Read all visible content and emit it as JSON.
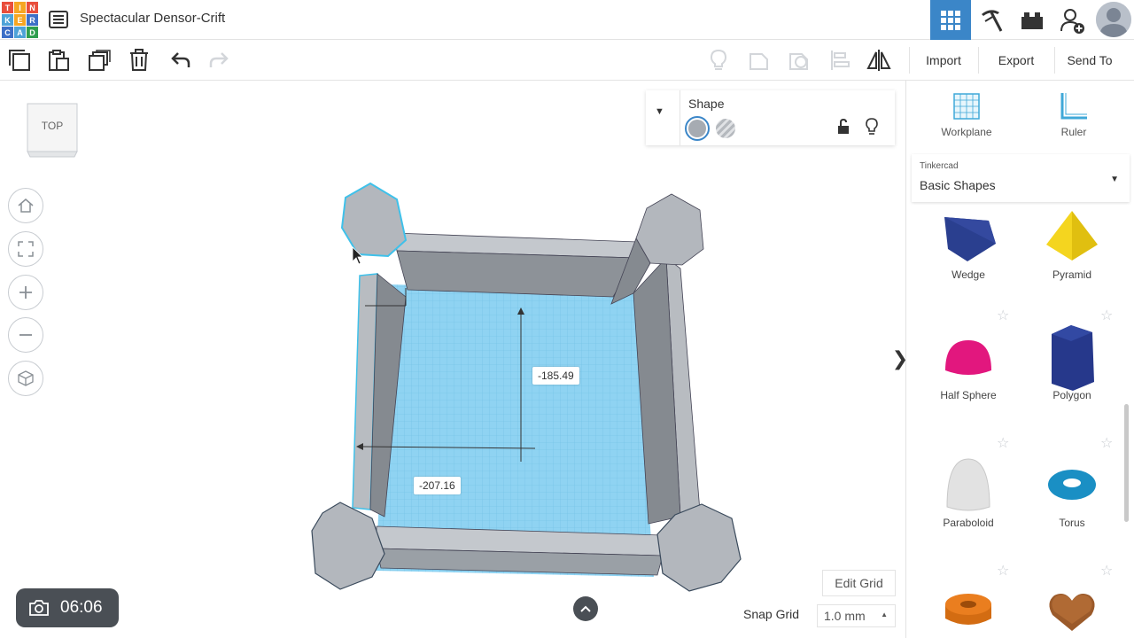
{
  "app": {
    "logo_letters": [
      "T",
      "I",
      "N",
      "K",
      "E",
      "R",
      "C",
      "A",
      "D"
    ],
    "logo_colors": [
      "#e94e3c",
      "#f6a623",
      "#e94e3c",
      "#4ea3d8",
      "#f6a623",
      "#3c6fc7",
      "#3c6fc7",
      "#4ea3d8",
      "#2f9e4f"
    ],
    "project_title": "Spectacular Densor-Crift"
  },
  "header": {
    "icons": [
      "grid-view-icon",
      "build-pickaxe-icon",
      "lego-brick-icon",
      "add-user-icon",
      "profile-avatar"
    ],
    "accent": "#3b86c8"
  },
  "toolbar": {
    "import_label": "Import",
    "export_label": "Export",
    "send_to_label": "Send To"
  },
  "viewport": {
    "viewcube_label": "TOP",
    "shape_panel": {
      "title": "Shape"
    },
    "dimensions": {
      "y_value": "-185.49",
      "x_value": "-207.16"
    },
    "timer": "06:06",
    "edit_grid_label": "Edit Grid",
    "snap_grid_label": "Snap Grid",
    "snap_grid_value": "1.0 mm",
    "workplane_color": "#8fd3f2",
    "shape_color": "#a6abb2",
    "selection_color": "#3fc1ea"
  },
  "sidebar": {
    "tools": [
      {
        "label": "Workplane"
      },
      {
        "label": "Ruler"
      }
    ],
    "library": {
      "source": "Tinkercad",
      "selected": "Basic Shapes"
    },
    "shapes": [
      {
        "label": "Wedge",
        "color": "#2a3f8f"
      },
      {
        "label": "Pyramid",
        "color": "#f2d11c"
      },
      {
        "label": "Half Sphere",
        "color": "#e2177e"
      },
      {
        "label": "Polygon",
        "color": "#26388b"
      },
      {
        "label": "Paraboloid",
        "color": "#d9d9d9"
      },
      {
        "label": "Torus",
        "color": "#1a8fc4"
      },
      {
        "label": "",
        "color": "#ea7e1f"
      },
      {
        "label": "",
        "color": "#9b5a2a"
      }
    ]
  }
}
